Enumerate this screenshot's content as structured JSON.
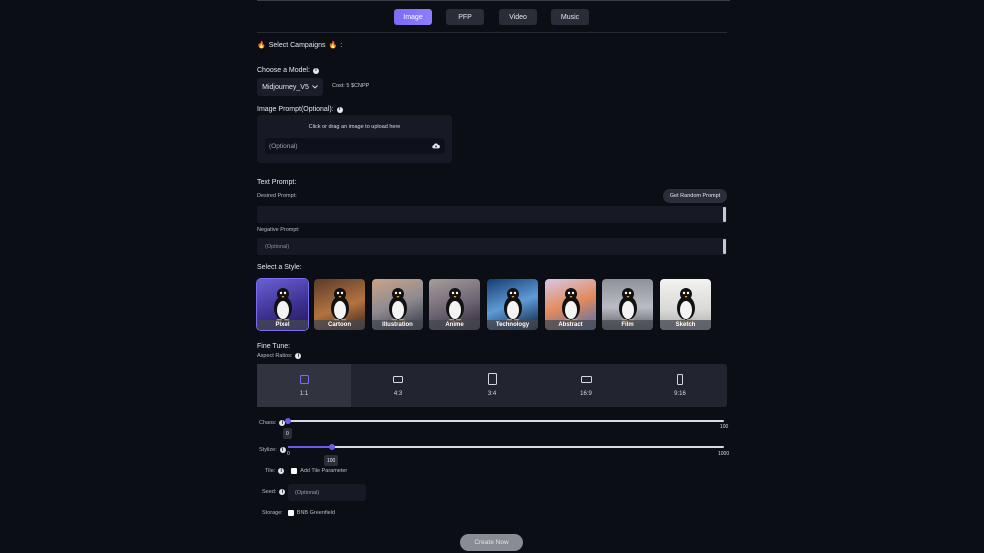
{
  "tabs": [
    {
      "label": "Image",
      "active": true
    },
    {
      "label": "PFP",
      "active": false
    },
    {
      "label": "Video",
      "active": false
    },
    {
      "label": "Music",
      "active": false
    }
  ],
  "campaigns": {
    "label": "Select Campaigns",
    "suffix": ":"
  },
  "model": {
    "label": "Choose a Model:",
    "selected": "Midjourney_V5",
    "cost": "Cost: 5 $CNPP"
  },
  "image_prompt": {
    "label": "Image Prompt(Optional):",
    "hint": "Click or drag an image to upload here",
    "placeholder": "(Optional)"
  },
  "text_prompt": {
    "label": "Text Prompt:",
    "desired_label": "Desired Prompt:",
    "random_button": "Get Random Prompt",
    "negative_label": "Negative Prompt:",
    "negative_placeholder": "(Optional)"
  },
  "styles": {
    "label": "Select a Style:",
    "items": [
      "Pixel",
      "Cartoon",
      "Illustration",
      "Anime",
      "Technology",
      "Abstract",
      "Film",
      "Sketch"
    ],
    "selected": "Pixel"
  },
  "fine_tune": {
    "label": "Fine Tune:",
    "aspect_label": "Aspect Ratios:",
    "ratios": [
      "1:1",
      "4:3",
      "3:4",
      "16:9",
      "9:16"
    ],
    "selected_ratio": "1:1"
  },
  "chaos": {
    "label": "Chaos:",
    "value": "0",
    "min": "0",
    "max": "100"
  },
  "stylize": {
    "label": "Stylize:",
    "value": "100",
    "min": "0",
    "max": "1000"
  },
  "tile": {
    "label": "Tile:",
    "option": "Add Tile Parameter"
  },
  "seed": {
    "label": "Seed:",
    "placeholder": "(Optional)"
  },
  "storage": {
    "label": "Storage:",
    "option": "BNB Greenfield"
  },
  "create_button": "Create Now",
  "colors": {
    "accent": "#7b6cf6",
    "background": "#0c0e16",
    "panel": "#171a25"
  }
}
